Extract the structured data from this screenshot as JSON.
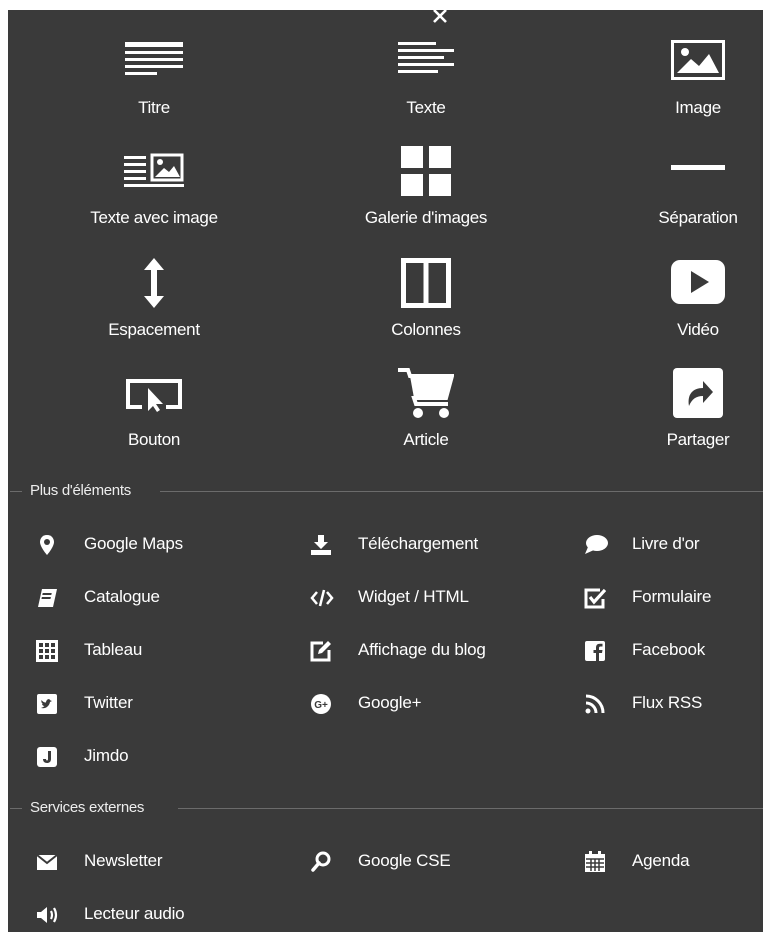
{
  "close_icon": "close-icon",
  "tiles": [
    {
      "label": "Titre",
      "icon": "title-icon"
    },
    {
      "label": "Texte",
      "icon": "text-icon"
    },
    {
      "label": "Image",
      "icon": "image-icon"
    },
    {
      "label": "Texte avec image",
      "icon": "text-with-image-icon"
    },
    {
      "label": "Galerie d'images",
      "icon": "gallery-icon"
    },
    {
      "label": "Séparation",
      "icon": "separator-icon"
    },
    {
      "label": "Espacement",
      "icon": "spacing-icon"
    },
    {
      "label": "Colonnes",
      "icon": "columns-icon"
    },
    {
      "label": "Vidéo",
      "icon": "video-icon"
    },
    {
      "label": "Bouton",
      "icon": "button-icon"
    },
    {
      "label": "Article",
      "icon": "cart-icon"
    },
    {
      "label": "Partager",
      "icon": "share-icon"
    }
  ],
  "more_elements": {
    "title": "Plus d'éléments",
    "items": [
      {
        "label": "Google Maps",
        "icon": "map-pin-icon"
      },
      {
        "label": "Téléchargement",
        "icon": "download-icon"
      },
      {
        "label": "Livre d'or",
        "icon": "speech-bubble-icon"
      },
      {
        "label": "Catalogue",
        "icon": "catalogue-icon"
      },
      {
        "label": "Widget / HTML",
        "icon": "code-icon"
      },
      {
        "label": "Formulaire",
        "icon": "form-checkbox-icon"
      },
      {
        "label": "Tableau",
        "icon": "table-icon"
      },
      {
        "label": "Affichage du blog",
        "icon": "edit-icon"
      },
      {
        "label": "Facebook",
        "icon": "facebook-icon"
      },
      {
        "label": "Twitter",
        "icon": "twitter-icon"
      },
      {
        "label": "Google+",
        "icon": "google-plus-icon"
      },
      {
        "label": "Flux RSS",
        "icon": "rss-icon"
      },
      {
        "label": "Jimdo",
        "icon": "jimdo-icon"
      }
    ]
  },
  "external_services": {
    "title": "Services externes",
    "items": [
      {
        "label": "Newsletter",
        "icon": "envelope-icon"
      },
      {
        "label": "Google CSE",
        "icon": "search-icon"
      },
      {
        "label": "Agenda",
        "icon": "calendar-icon"
      },
      {
        "label": "Lecteur audio",
        "icon": "speaker-icon"
      }
    ]
  }
}
